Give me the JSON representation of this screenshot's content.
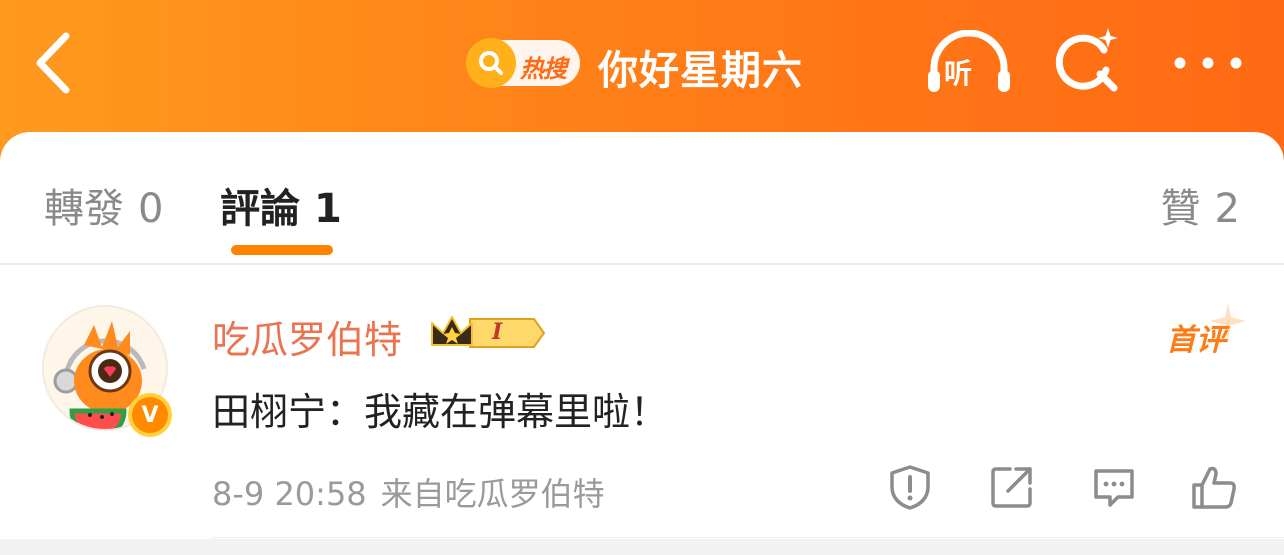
{
  "header": {
    "hot_badge_label": "热搜",
    "topic_title": "你好星期六",
    "listen_label": "听"
  },
  "tabs": [
    {
      "label": "轉發",
      "count": "0"
    },
    {
      "label": "評論",
      "count": "1"
    },
    {
      "label": "贊",
      "count": "2"
    }
  ],
  "comment": {
    "username": "吃瓜罗伯特",
    "crown_level": "I",
    "first_comment_badge": "首评",
    "vip_mark": "V",
    "text": "田栩宁：我藏在弹幕里啦！",
    "time": "8-9 20:58",
    "source": "来自吃瓜罗伯特"
  },
  "colors": {
    "brand_orange": "#ff7b17",
    "username": "#eb7350",
    "tab_indicator": "#ff8200"
  },
  "icons": [
    "back-arrow-icon",
    "search-icon",
    "headphones-icon",
    "sparkle-search-icon",
    "more-dots-icon",
    "report-icon",
    "repost-icon",
    "reply-icon",
    "like-icon",
    "crown-icon",
    "vip-v-icon"
  ]
}
